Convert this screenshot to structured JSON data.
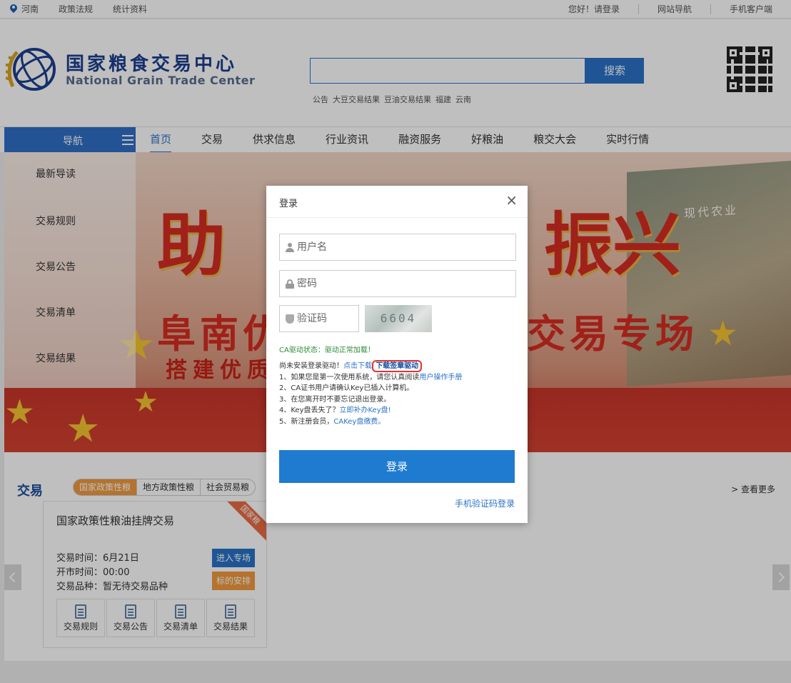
{
  "topbar": {
    "region": "河南",
    "links": [
      "政策法规",
      "统计资料"
    ],
    "right": [
      "您好！请登录",
      "网站导航",
      "手机客户端"
    ]
  },
  "header": {
    "brand_cn": "国家粮食交易中心",
    "brand_en": "National Grain Trade Center",
    "search_button": "搜索",
    "search_value": "",
    "hot_keywords": [
      "公告",
      "大豆交易结果",
      "豆油交易结果",
      "福建",
      "云南"
    ]
  },
  "nav": {
    "side_label": "导航",
    "items": [
      "首页",
      "交易",
      "供求信息",
      "行业资讯",
      "融资服务",
      "好粮油",
      "粮交大会",
      "实时行情"
    ],
    "active": "首页"
  },
  "sidemenu": [
    "最新导读",
    "交易规则",
    "交易公告",
    "交易清单",
    "交易结果"
  ],
  "banner": {
    "big_left": "助",
    "big_right": "振兴",
    "mid_left": "阜南优",
    "mid_right": "交易专场",
    "small_left": "搭建优质",
    "poster_text": "现代农业"
  },
  "trade": {
    "title": "交易",
    "tabs": [
      "国家政策性粮",
      "地方政策性粮",
      "社会贸易粮"
    ],
    "active_tab": "国家政策性粮",
    "more": "> 查看更多",
    "card": {
      "title": "国家政策性粮油挂牌交易",
      "ribbon": "国家粮",
      "trade_time": "交易时间：6月21日",
      "open_time": "开市时间：00:00",
      "variety": "交易品种：暂无待交易品种",
      "enter_button": "进入专场",
      "schedule_button": "标的安排",
      "icons": [
        "交易规则",
        "交易公告",
        "交易清单",
        "交易结果"
      ]
    }
  },
  "login_modal": {
    "title": "登录",
    "close": "×",
    "username_placeholder": "用户名",
    "password_placeholder": "密码",
    "captcha_placeholder": "验证码",
    "captcha_code": "6604",
    "ca_status": "CA驱动状态：驱动正常加载！",
    "line0_prefix": "尚未安装登录驱动！",
    "line0_link1": "点击下载",
    "line0_link2": "下载签章驱动",
    "line1_prefix": "1、如果您是第一次使用系统，请您认真阅读",
    "line1_link": "用户操作手册",
    "line2": "2、CA证书用户请确认Key已插入计算机。",
    "line3": "3、在您离开时不要忘记退出登录。",
    "line4_prefix": "4、Key盘丢失了？",
    "line4_link": "立即补办Key盘!",
    "line5_prefix": "5、新注册会员，",
    "line5_link": "CAKey盘缴费。",
    "login_button": "登录",
    "sms_login": "手机验证码登录"
  }
}
